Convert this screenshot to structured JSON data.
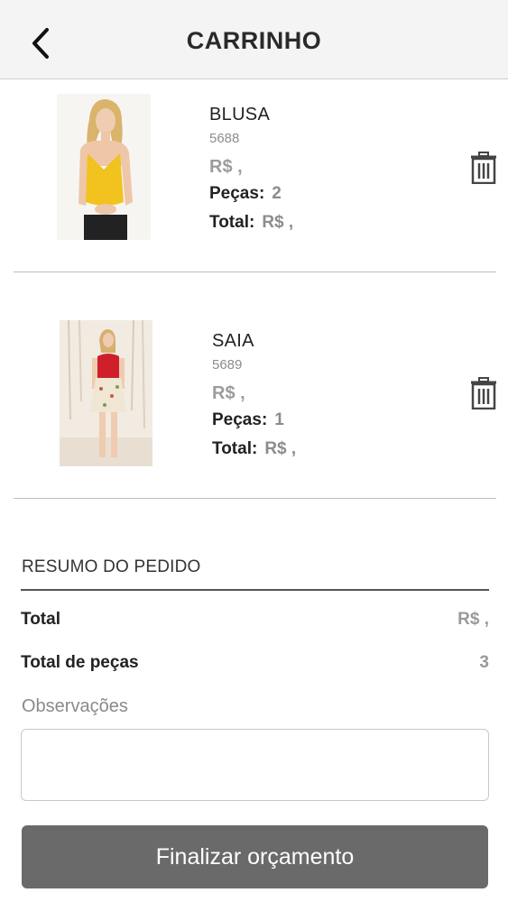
{
  "header": {
    "title": "CARRINHO",
    "back_icon": "chevron-left-icon"
  },
  "cart": {
    "items": [
      {
        "name": "BLUSA",
        "code": "5688",
        "price": "R$      ,",
        "pieces_label": "Peças:",
        "pieces": "2",
        "total_label": "Total:",
        "total": "R$      ,",
        "image_icon": "product-photo-blouse",
        "garment_color": "#f2c21e",
        "delete_icon": "trash-icon"
      },
      {
        "name": "SAIA",
        "code": "5689",
        "price": "R$      ,",
        "pieces_label": "Peças:",
        "pieces": "1",
        "total_label": "Total:",
        "total": "R$      ,",
        "image_icon": "product-photo-skirt",
        "garment_color": "#cf1f2b",
        "delete_icon": "trash-icon"
      }
    ]
  },
  "summary": {
    "title": "RESUMO DO PEDIDO",
    "total_label": "Total",
    "total_value": "R$      ,",
    "pieces_label": "Total de peças",
    "pieces_value": "3",
    "notes_label": "Observações",
    "notes_value": "",
    "submit_label": "Finalizar orçamento"
  }
}
